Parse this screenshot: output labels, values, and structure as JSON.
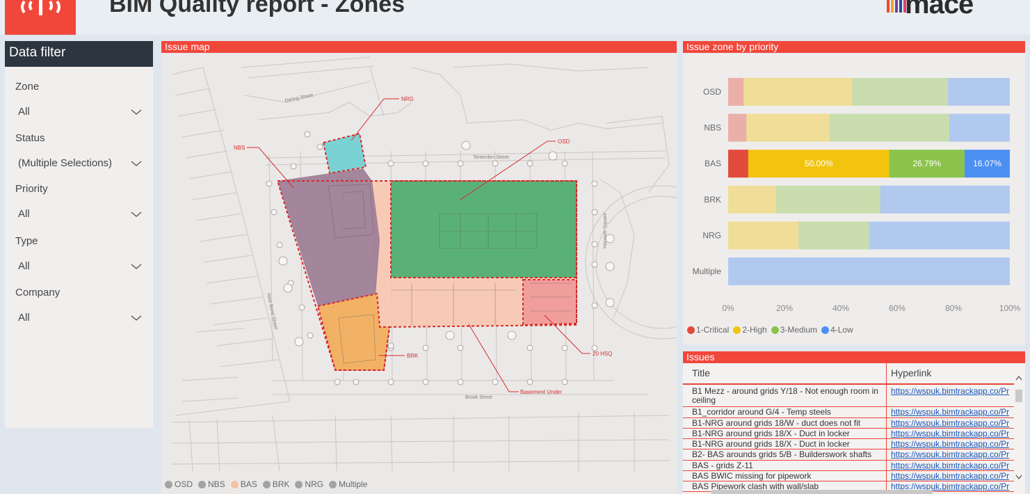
{
  "header": {
    "title": "BIM Quality report - Zones",
    "brand": "mace",
    "brand_bar_colors": [
      "#f1473a",
      "#f0a42c",
      "#7b3f98",
      "#2a4b9b",
      "#e33f6e"
    ]
  },
  "filter": {
    "heading": "Data filter",
    "fields": [
      {
        "label": "Zone",
        "value": "All"
      },
      {
        "label": "Status",
        "value": "(Multiple Selections)"
      },
      {
        "label": "Priority",
        "value": "All"
      },
      {
        "label": "Type",
        "value": "All"
      },
      {
        "label": "Company",
        "value": "All"
      }
    ]
  },
  "issue_map": {
    "heading": "Issue map",
    "callouts": [
      "NRG",
      "NBS",
      "OSD",
      "BRK",
      "20 HSQ",
      "Basement Under"
    ],
    "streets": [
      "Dering Street",
      "Tenterden Street",
      "Brook Street",
      "New Bond Street",
      "Hanover Square"
    ],
    "legend": [
      {
        "label": "OSD",
        "color": "#a3a3a3"
      },
      {
        "label": "NBS",
        "color": "#a3a3a3"
      },
      {
        "label": "BAS",
        "color": "#f9bfa3"
      },
      {
        "label": "BRK",
        "color": "#a3a3a3"
      },
      {
        "label": "NRG",
        "color": "#a3a3a3"
      },
      {
        "label": "Multiple",
        "color": "#a3a3a3"
      }
    ],
    "zone_colors": {
      "OSD": "#4caf73",
      "NBS": "#9b7a93",
      "NRG": "#6fcfd3",
      "BRK": "#f2ad5a",
      "BAS": "#f9c4ac",
      "20 HSQ": "#ef9a9a"
    }
  },
  "priority_chart": {
    "heading": "Issue zone by priority",
    "legend": [
      {
        "label": "1-Critical",
        "color": "#e24a3b"
      },
      {
        "label": "2-High",
        "color": "#f2c40f"
      },
      {
        "label": "3-Medium",
        "color": "#8bc34a"
      },
      {
        "label": "4-Low",
        "color": "#4c8ff2"
      }
    ],
    "x_ticks": [
      "0%",
      "20%",
      "40%",
      "60%",
      "80%",
      "100%"
    ]
  },
  "chart_data": {
    "type": "bar",
    "orientation": "horizontal",
    "stacked": "percent",
    "title": "Issue zone by priority",
    "categories": [
      "OSD",
      "NBS",
      "BAS",
      "BRK",
      "NRG",
      "Multiple"
    ],
    "highlighted_category": "BAS",
    "series": [
      {
        "name": "1-Critical",
        "color": "#e24a3b",
        "values": [
          5.5,
          6.5,
          7.14,
          0,
          0,
          0
        ]
      },
      {
        "name": "2-High",
        "color": "#f2c40f",
        "values": [
          38.5,
          29.5,
          50.0,
          17,
          25,
          0
        ]
      },
      {
        "name": "3-Medium",
        "color": "#8bc34a",
        "values": [
          34,
          42.5,
          26.79,
          37,
          25,
          0
        ]
      },
      {
        "name": "4-Low",
        "color": "#4c8ff2",
        "values": [
          22,
          21.5,
          16.07,
          46,
          50,
          100
        ]
      }
    ],
    "data_labels": {
      "BAS": [
        "",
        "50.00%",
        "26.79%",
        "16.07%"
      ]
    },
    "xlim": [
      0,
      100
    ],
    "legend_position": "bottom-left",
    "grid": false
  },
  "issues": {
    "heading": "Issues",
    "columns": [
      "Title",
      "Hyperlink"
    ],
    "rows": [
      {
        "title": "B1 Mezz - around grids Y/18 - Not enough room in ceiling",
        "link": "https://wspuk.bimtrackapp.co/Pr"
      },
      {
        "title": "B1_corridor around G/4 - Temp steels",
        "link": "https://wspuk.bimtrackapp.co/Pr"
      },
      {
        "title": "B1-NRG around grids 18/W - duct does not fit",
        "link": "https://wspuk.bimtrackapp.co/Pr"
      },
      {
        "title": "B1-NRG around grids 18/X - Duct in locker",
        "link": "https://wspuk.bimtrackapp.co/Pr"
      },
      {
        "title": "B1-NRG around grids 18/X - Duct in locker",
        "link": "https://wspuk.bimtrackapp.co/Pr"
      },
      {
        "title": "B2- BAS arounds grids 5/B - Builderswork shafts",
        "link": "https://wspuk.bimtrackapp.co/Pr"
      },
      {
        "title": "BAS - grids Z-11",
        "link": "https://wspuk.bimtrackapp.co/Pr"
      },
      {
        "title": "BAS BWIC missing for pipework",
        "link": "https://wspuk.bimtrackapp.co/Pr"
      },
      {
        "title": "BAS Pipework clash with wall/slab",
        "link": "https://wspuk.bimtrackapp.co/Pr"
      }
    ]
  }
}
